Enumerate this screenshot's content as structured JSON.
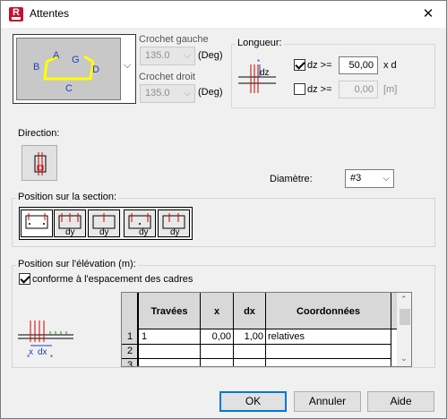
{
  "window": {
    "title": "Attentes",
    "app_icon_letter": "R",
    "close_glyph": "✕"
  },
  "hook_diagram": {
    "labels": {
      "A": "A",
      "B": "B",
      "G": "G",
      "D": "D",
      "C": "C"
    },
    "dropdown_glyph": "⌵"
  },
  "crochet_gauche": {
    "label": "Crochet gauche",
    "value": "135.0",
    "unit": "(Deg)"
  },
  "crochet_droit": {
    "label": "Crochet droit",
    "value": "135.0",
    "unit": "(Deg)"
  },
  "longueur": {
    "title": "Longueur:",
    "diagram_label": "dz",
    "row1": {
      "checked": true,
      "label": "dz >=",
      "value": "50,00",
      "unit": "x d"
    },
    "row2": {
      "checked": false,
      "label": "dz >=",
      "value": "0,00",
      "unit": "[m]"
    }
  },
  "direction": {
    "label": "Direction:"
  },
  "diametre": {
    "label": "Diamètre:",
    "value": "#3",
    "arrow": "⌵"
  },
  "position_section": {
    "title": "Position sur la section:",
    "buttons": [
      {
        "label": ""
      },
      {
        "label": "dy"
      },
      {
        "label": "dy"
      },
      {
        "label": "dy"
      },
      {
        "label": "dy"
      }
    ]
  },
  "position_elevation": {
    "title": "Position sur l'élévation (m):",
    "checkbox": {
      "checked": true,
      "label": "conforme à l'espacement des cadres"
    },
    "diagram_labels": {
      "x": "x",
      "dx": "dx"
    },
    "table": {
      "columns": [
        "Travées",
        "x",
        "dx",
        "Coordonnées"
      ],
      "rows": [
        {
          "num": "1",
          "travees": "1",
          "x": "0,00",
          "dx": "1,00",
          "coord": "relatives"
        },
        {
          "num": "2",
          "travees": "",
          "x": "",
          "dx": "",
          "coord": ""
        },
        {
          "num": "3",
          "travees": "",
          "x": "",
          "dx": "",
          "coord": ""
        }
      ]
    }
  },
  "buttons": {
    "ok": "OK",
    "annuler": "Annuler",
    "aide": "Aide"
  },
  "colors": {
    "accent": "#0078d7",
    "hook_yellow": "#ffff00",
    "rebar_red": "#d00000",
    "diagram_blue": "#1f3fbf"
  }
}
